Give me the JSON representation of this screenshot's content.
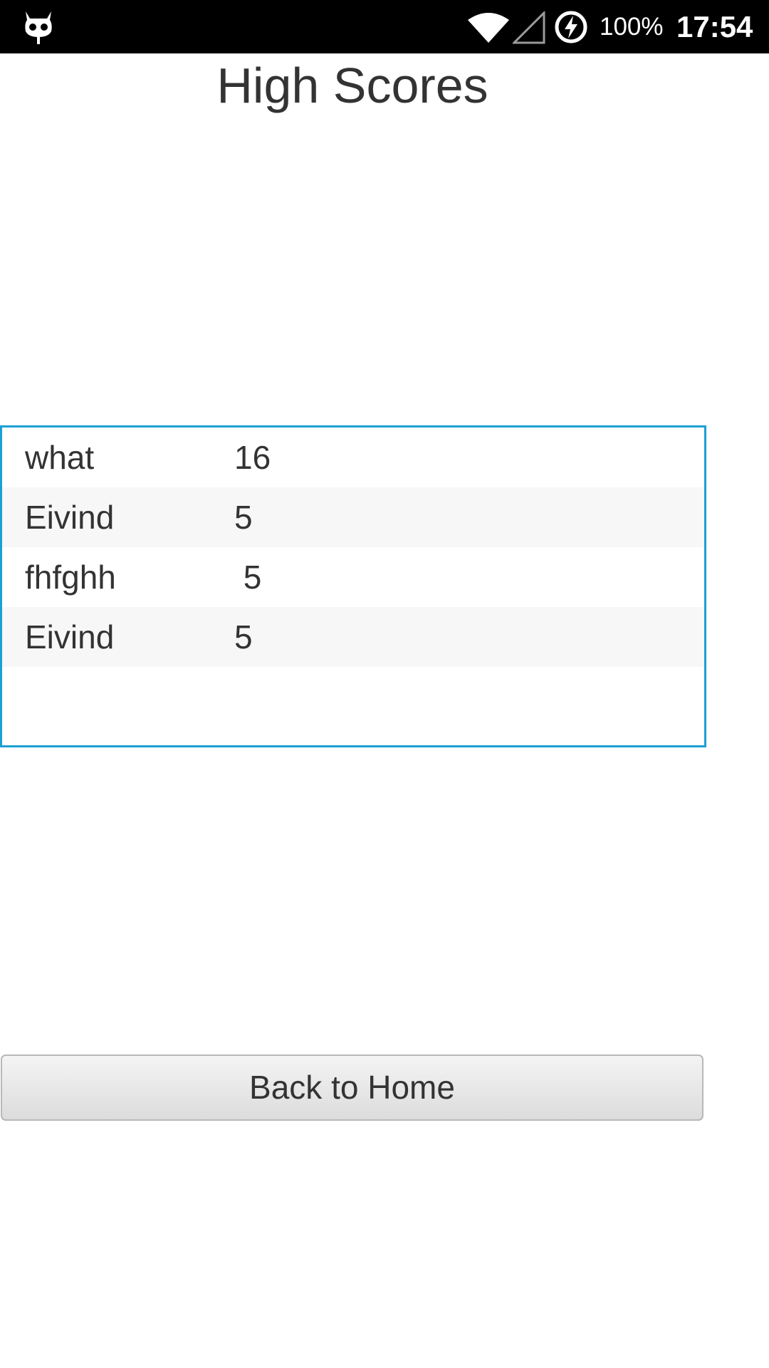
{
  "status_bar": {
    "battery_percent": "100%",
    "time": "17:54",
    "icons": [
      "android-debug-icon",
      "wifi-icon",
      "cell-signal-icon",
      "battery-charging-icon"
    ]
  },
  "page": {
    "title": "High Scores"
  },
  "scores": [
    {
      "name": "what",
      "score": "16"
    },
    {
      "name": "Eivind",
      "score": "5"
    },
    {
      "name": "fhfghh",
      "score": " 5"
    },
    {
      "name": "Eivind",
      "score": "5"
    },
    {
      "name": "",
      "score": ""
    }
  ],
  "actions": {
    "back_label": "Back to Home"
  },
  "colors": {
    "list_border": "#1ba0d3",
    "status_bar": "#000000",
    "text": "#333333"
  }
}
